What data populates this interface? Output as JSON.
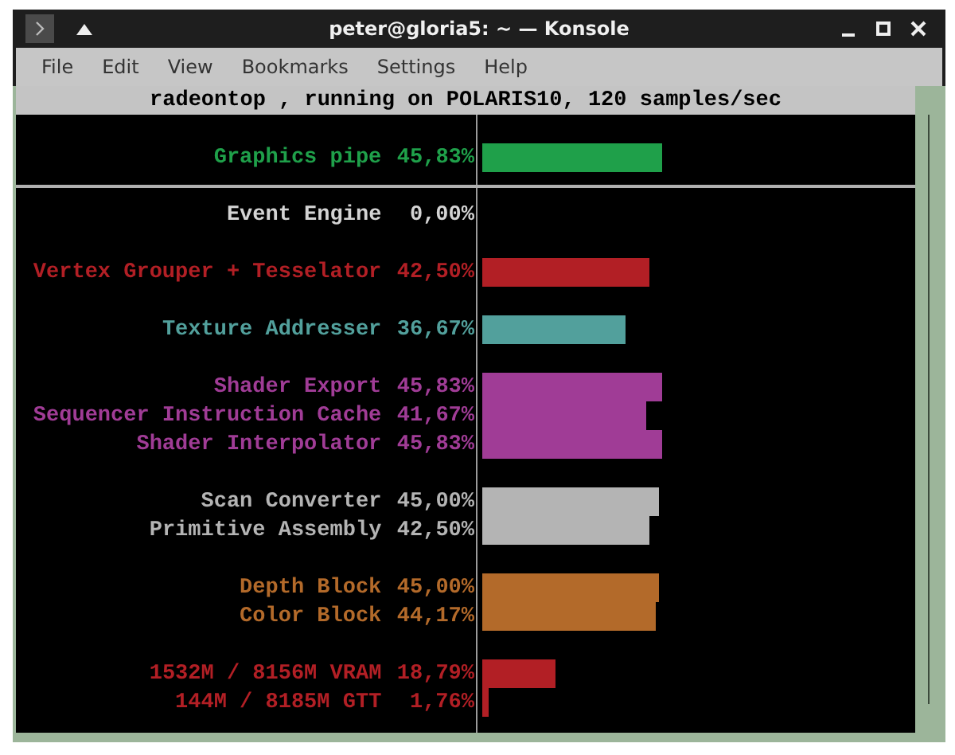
{
  "window": {
    "title": "peter@gloria5: ~ — Konsole"
  },
  "menu": [
    "File",
    "Edit",
    "View",
    "Bookmarks",
    "Settings",
    "Help"
  ],
  "terminal": {
    "header": "radeontop , running on POLARIS10, 120 samples/sec",
    "groups": [
      {
        "kind": "meters",
        "items": [
          {
            "label": "Graphics pipe",
            "value": "45,83%",
            "level": 0.4583,
            "color": "#1fa04a"
          }
        ]
      },
      {
        "kind": "rule"
      },
      {
        "kind": "meters",
        "items": [
          {
            "label": "Event Engine",
            "value": "0,00%",
            "color": "#d4d4d4"
          }
        ]
      },
      {
        "kind": "meters",
        "items": [
          {
            "label": "Vertex Grouper + Tesselator",
            "value": "42,50%",
            "level": 0.425,
            "color": "#b21f25"
          }
        ]
      },
      {
        "kind": "meters",
        "items": [
          {
            "label": "Texture Addresser",
            "value": "36,67%",
            "level": 0.3667,
            "color": "#52a09c"
          }
        ]
      },
      {
        "kind": "meters",
        "items": [
          {
            "label": "Shader Export",
            "value": "45,83%",
            "level": 0.4583,
            "color": "#a03c96"
          },
          {
            "label": "Sequencer Instruction Cache",
            "value": "41,67%",
            "level": 0.4167,
            "color": "#a03c96"
          },
          {
            "label": "Shader Interpolator",
            "value": "45,83%",
            "level": 0.4583,
            "color": "#a03c96"
          }
        ]
      },
      {
        "kind": "meters",
        "items": [
          {
            "label": "Scan Converter",
            "value": "45,00%",
            "level": 0.45,
            "color": "#b4b4b4"
          },
          {
            "label": "Primitive Assembly",
            "value": "42,50%",
            "level": 0.425,
            "color": "#b4b4b4"
          }
        ]
      },
      {
        "kind": "meters",
        "items": [
          {
            "label": "Depth Block",
            "value": "45,00%",
            "level": 0.45,
            "color": "#b36a2a"
          },
          {
            "label": "Color Block",
            "value": "44,17%",
            "level": 0.4417,
            "color": "#b36a2a"
          }
        ]
      },
      {
        "kind": "meters",
        "items": [
          {
            "label": "1532M / 8156M VRAM",
            "value": "18,79%",
            "level": 0.1879,
            "color": "#b21f25"
          },
          {
            "label": "144M / 8185M GTT",
            "value": "1,76%",
            "level": 0.0176,
            "color": "#b21f25"
          }
        ]
      }
    ]
  }
}
